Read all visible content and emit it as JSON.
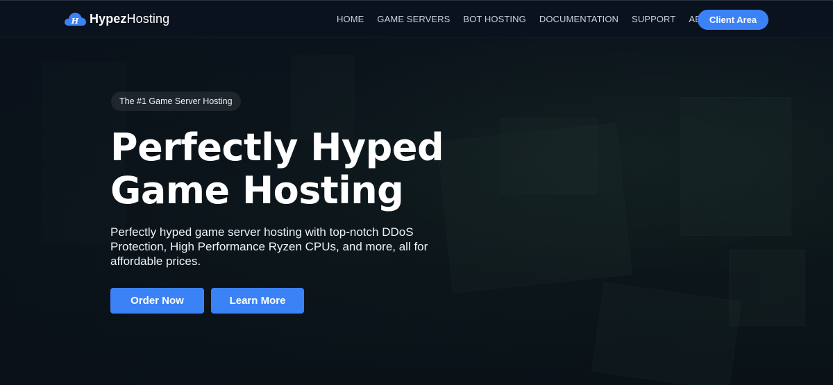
{
  "brand": {
    "name_bold": "Hypez",
    "name_light": "Hosting",
    "logo_letter": "H"
  },
  "nav": {
    "links": [
      "HOME",
      "GAME SERVERS",
      "BOT HOSTING",
      "DOCUMENTATION",
      "SUPPORT",
      "ABOUT"
    ],
    "client_area_label": "Client Area"
  },
  "hero": {
    "badge": "The #1 Game Server Hosting",
    "title_line1": "Perfectly Hyped",
    "title_line2": "Game Hosting",
    "subtitle": "Perfectly hyped game server hosting with top-notch DDoS Protection, High Performance Ryzen CPUs, and more, all for affordable prices.",
    "order_label": "Order Now",
    "learn_label": "Learn More"
  },
  "colors": {
    "accent": "#3b82f6",
    "navbar_bg": "#0a121e",
    "page_bg": "#0b1420"
  }
}
